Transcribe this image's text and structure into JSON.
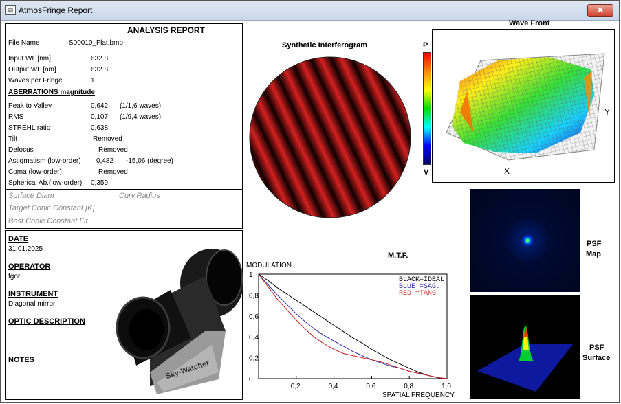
{
  "window": {
    "title": "AtmosFringe  Report",
    "close_label": "✕",
    "app_icon": "document-icon"
  },
  "report": {
    "title": "ANALYSIS  REPORT",
    "rows": [
      {
        "label": "File Name",
        "value": "S00010_Flat.bmp"
      },
      {
        "label": "Input  WL [nm]",
        "value": "632.8"
      },
      {
        "label": "Output WL [nm]",
        "value": "632.8"
      },
      {
        "label": "Waves per Fringe",
        "value": "1"
      }
    ],
    "aberr_title": "ABERRATIONS magnitude",
    "aberr": [
      {
        "label": "Peak to Valley",
        "value": "0,642",
        "extra": "(1/1,6 waves)"
      },
      {
        "label": "RMS",
        "value": "0,107",
        "extra": "(1/9,4 waves)"
      },
      {
        "label": "STREHL ratio",
        "value": "0,638",
        "extra": ""
      },
      {
        "label": "Tilt",
        "value": "Removed",
        "extra": ""
      },
      {
        "label": "Defocus",
        "value": "Removed",
        "extra": ""
      },
      {
        "label": "Astigmatism  (low-order)",
        "value": "0,482",
        "extra": "-15,06  (degree)"
      },
      {
        "label": "Coma        (low-order)",
        "value": "Removed",
        "extra": ""
      },
      {
        "label": "Spherical Ab.(low-order)",
        "value": "0,359",
        "extra": ""
      }
    ],
    "surface_diam": "Surface Diam",
    "curv_radius": "Curv.Radius",
    "target_conic": "Target Conic Constant [K]",
    "best_conic": "Best Conic Constant Fit"
  },
  "info": {
    "date_title": "DATE",
    "date": "31.01.2025",
    "operator_title": "OPERATOR",
    "operator": "fgor",
    "instrument_title": "INSTRUMENT",
    "instrument": "Diagonal mirror",
    "optic_title": "OPTIC DESCRIPTION",
    "notes_title": "NOTES",
    "brand_logo": "Sky-Watcher"
  },
  "interferogram": {
    "title": "Synthetic Interferogram",
    "scale_top": "P",
    "scale_bottom": "V"
  },
  "wavefront": {
    "title": "Wave Front",
    "x_label": "X",
    "y_label": "Y"
  },
  "psf": {
    "map_label_1": "PSF",
    "map_label_2": "Map",
    "surface_label_1": "PSF",
    "surface_label_2": "Surface"
  },
  "chart_data": {
    "type": "line",
    "title": "M.T.F.",
    "ylabel": "MODULATION",
    "xlabel": "SPATIAL FREQUENCY",
    "xlim": [
      0,
      1
    ],
    "ylim": [
      0,
      1
    ],
    "x_ticks": [
      "0,2",
      "0,4",
      "0,6",
      "0,8",
      "1,0"
    ],
    "y_ticks": [
      "0",
      "0,2",
      "0,4",
      "0,6",
      "0,8",
      "1"
    ],
    "legend": [
      "BLACK=IDEAL",
      "BLUE  =SAG.",
      "RED   =TANG"
    ],
    "x": [
      0,
      0.05,
      0.1,
      0.15,
      0.2,
      0.25,
      0.3,
      0.35,
      0.4,
      0.45,
      0.5,
      0.55,
      0.6,
      0.65,
      0.7,
      0.75,
      0.8,
      0.85,
      0.9,
      0.95,
      1.0
    ],
    "series": [
      {
        "name": "IDEAL",
        "color": "#000000",
        "values": [
          1.0,
          0.94,
          0.87,
          0.81,
          0.75,
          0.69,
          0.63,
          0.57,
          0.51,
          0.45,
          0.39,
          0.34,
          0.28,
          0.23,
          0.18,
          0.14,
          0.1,
          0.06,
          0.03,
          0.01,
          0
        ]
      },
      {
        "name": "SAG.",
        "color": "#2a2aa0",
        "values": [
          1.0,
          0.9,
          0.8,
          0.71,
          0.62,
          0.54,
          0.47,
          0.41,
          0.36,
          0.31,
          0.26,
          0.22,
          0.18,
          0.15,
          0.12,
          0.1,
          0.07,
          0.05,
          0.03,
          0.01,
          0
        ]
      },
      {
        "name": "TANG",
        "color": "#cc2020",
        "values": [
          1.0,
          0.88,
          0.76,
          0.66,
          0.56,
          0.47,
          0.39,
          0.33,
          0.28,
          0.24,
          0.22,
          0.2,
          0.18,
          0.16,
          0.13,
          0.1,
          0.07,
          0.05,
          0.03,
          0.01,
          0
        ]
      }
    ]
  }
}
